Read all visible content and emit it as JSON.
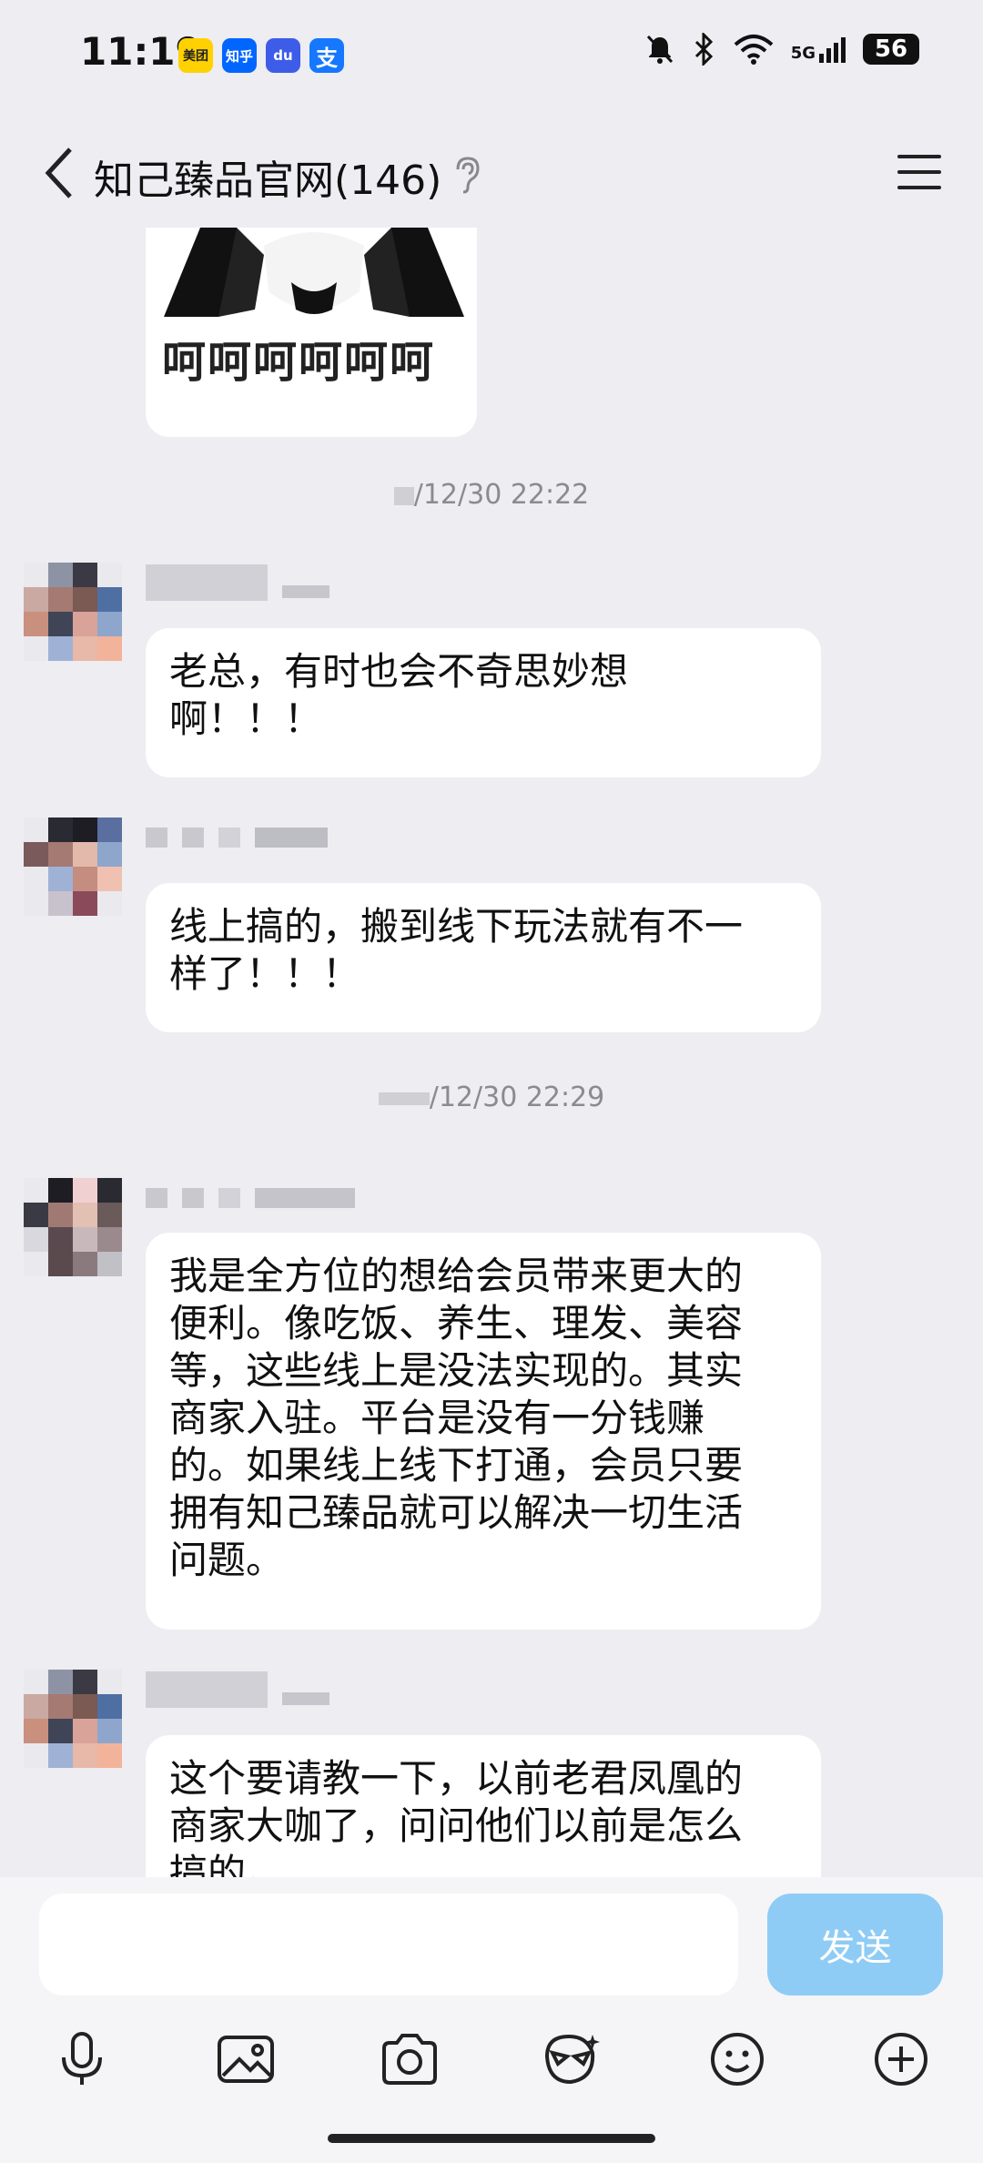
{
  "status": {
    "time": "11:19",
    "apps": [
      {
        "name": "meituan-icon",
        "label": "美团",
        "color": "#FFD100"
      },
      {
        "name": "zhihu-icon",
        "label": "知乎",
        "color": "#0066FF"
      },
      {
        "name": "baidu-icon",
        "label": "du",
        "color": "#3D5CE8"
      },
      {
        "name": "alipay-icon",
        "label": "支",
        "color": "#1677FF"
      }
    ],
    "network": "5G",
    "battery": "56"
  },
  "header": {
    "title": "知己臻品官网(146)"
  },
  "sticker": {
    "text": "呵呵呵呵呵呵"
  },
  "timestamps": [
    "/12/30 22:22",
    "/12/30 22:29"
  ],
  "messages": [
    {
      "text": "老总，有时也会不奇思妙想\n啊！！！"
    },
    {
      "text": "线上搞的，搬到线下玩法就有不一\n样了！！！"
    },
    {
      "text": "我是全方位的想给会员带来更大的\n便利。像吃饭、养生、理发、美容\n等，这些线上是没法实现的。其实\n商家入驻。平台是没有一分钱赚\n的。如果线上线下打通，会员只要\n拥有知己臻品就可以解决一切生活\n问题。"
    },
    {
      "text": "这个要请教一下，以前老君凤凰的\n商家大咖了，问问他们以前是怎么\n搞的。"
    }
  ],
  "input": {
    "placeholder": "",
    "send_label": "发送"
  },
  "toolbar": [
    "mic-icon",
    "image-icon",
    "camera-icon",
    "sticker-icon",
    "emoji-icon",
    "plus-icon"
  ],
  "colors": {
    "background": "#EDEDF2",
    "bubble": "#FFFFFF",
    "send": "#8FCCF5"
  }
}
